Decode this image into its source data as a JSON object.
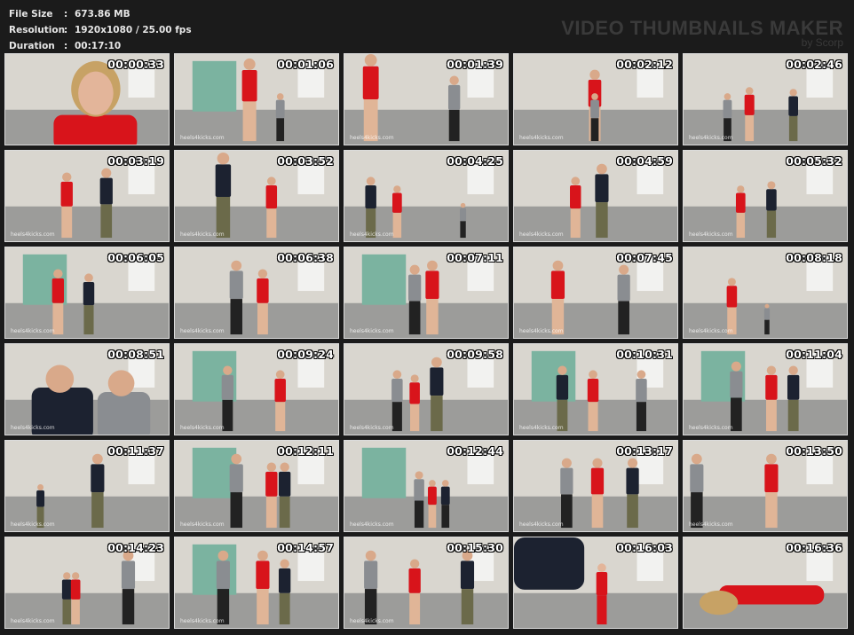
{
  "info": {
    "rows": [
      {
        "key": "File Size",
        "sep": ":",
        "value": "673.86 MB"
      },
      {
        "key": "Resolution",
        "sep": ":",
        "value": "1920x1080 / 25.00 fps"
      },
      {
        "key": "Duration",
        "sep": ":",
        "value": "00:17:10"
      }
    ]
  },
  "brand": {
    "title": "VIDEO THUMBNAILS MAKER",
    "subtitle": "by Scorp"
  },
  "watermark": "heels4kicks.com",
  "thumbnails": [
    {
      "time": "00:00:33"
    },
    {
      "time": "00:01:06"
    },
    {
      "time": "00:01:39"
    },
    {
      "time": "00:02:12"
    },
    {
      "time": "00:02:46"
    },
    {
      "time": "00:03:19"
    },
    {
      "time": "00:03:52"
    },
    {
      "time": "00:04:25"
    },
    {
      "time": "00:04:59"
    },
    {
      "time": "00:05:32"
    },
    {
      "time": "00:06:05"
    },
    {
      "time": "00:06:38"
    },
    {
      "time": "00:07:11"
    },
    {
      "time": "00:07:45"
    },
    {
      "time": "00:08:18"
    },
    {
      "time": "00:08:51"
    },
    {
      "time": "00:09:24"
    },
    {
      "time": "00:09:58"
    },
    {
      "time": "00:10:31"
    },
    {
      "time": "00:11:04"
    },
    {
      "time": "00:11:37"
    },
    {
      "time": "00:12:11"
    },
    {
      "time": "00:12:44"
    },
    {
      "time": "00:13:17"
    },
    {
      "time": "00:13:50"
    },
    {
      "time": "00:14:23"
    },
    {
      "time": "00:14:57"
    },
    {
      "time": "00:15:30"
    },
    {
      "time": "00:16:03"
    },
    {
      "time": "00:16:36"
    }
  ],
  "colors": {
    "background": "#1b1b1b",
    "wall": "#d9d6cf",
    "floor": "#9c9c9a",
    "panel": "#7bb3a0",
    "dress": "#d8141b",
    "shirt_dark": "#1c2230",
    "shirt_grey": "#8a8d91",
    "camo": "#6b6a4a"
  }
}
